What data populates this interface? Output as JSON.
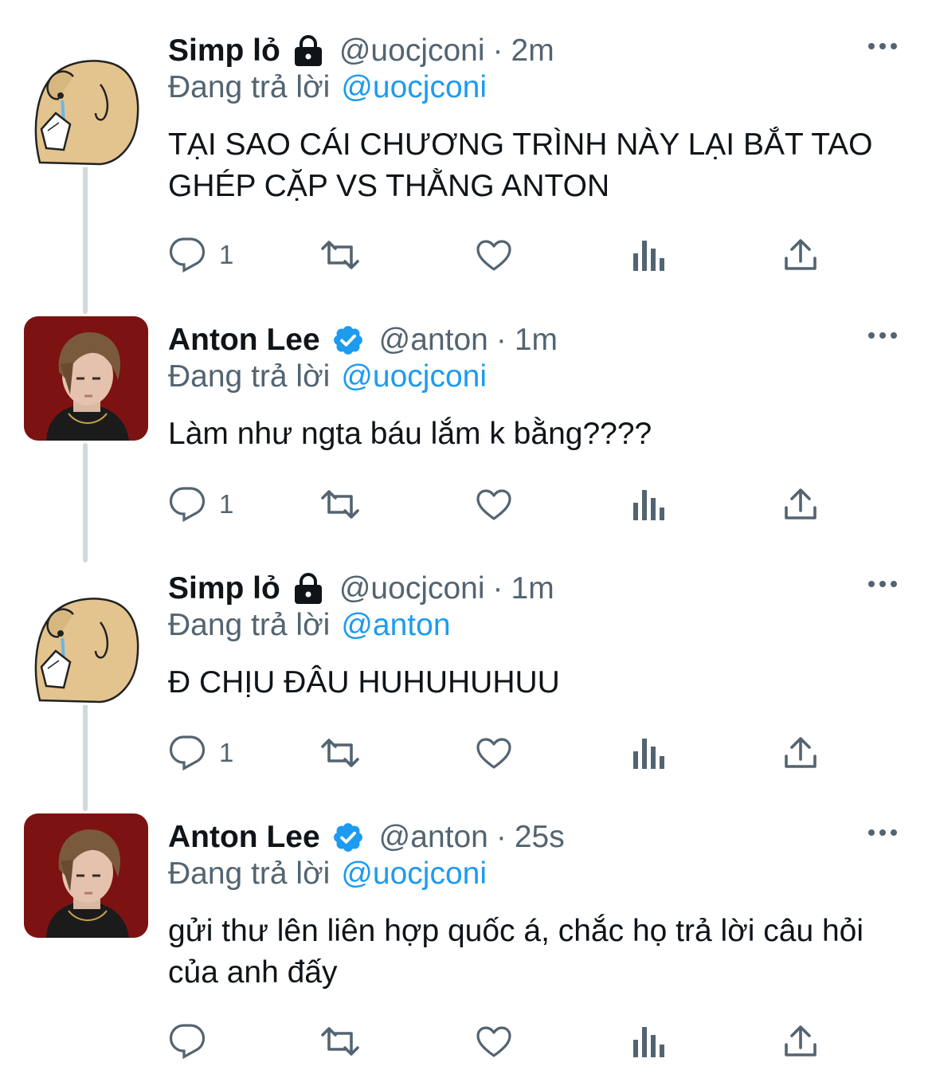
{
  "colors": {
    "text": "#0f1419",
    "secondary": "#536471",
    "link": "#1d9bf0",
    "thread_line": "#cfd9de",
    "verified": "#1d9bf0"
  },
  "tweets": [
    {
      "display_name": "Simp lỏ",
      "badge_icon": "lock-icon",
      "handle": "@uocjconi",
      "separator": "·",
      "time": "2m",
      "replying_label": "Đang trả lời",
      "replying_to": "@uocjconi",
      "text": "TẠI SAO CÁI CHƯƠNG TRÌNH NÀY LẠI BẮT TAO GHÉP CẶP VS THẰNG ANTON",
      "reply_count": "1"
    },
    {
      "display_name": "Anton Lee",
      "badge_icon": "verified-icon",
      "handle": "@anton",
      "separator": "·",
      "time": "1m",
      "replying_label": "Đang trả lời",
      "replying_to": "@uocjconi",
      "text": "Làm như ngta báu lắm k bằng????",
      "reply_count": "1"
    },
    {
      "display_name": "Simp lỏ",
      "badge_icon": "lock-icon",
      "handle": "@uocjconi",
      "separator": "·",
      "time": "1m",
      "replying_label": "Đang trả lời",
      "replying_to": "@anton",
      "text": "Đ CHỊU ĐÂU HUHUHUHUU",
      "reply_count": "1"
    },
    {
      "display_name": "Anton Lee",
      "badge_icon": "verified-icon",
      "handle": "@anton",
      "separator": "·",
      "time": "25s",
      "replying_label": "Đang trả lời",
      "replying_to": "@uocjconi",
      "text": "gửi thư lên liên hợp quốc á, chắc họ trả lời câu hỏi của anh đấy",
      "reply_count": ""
    }
  ]
}
